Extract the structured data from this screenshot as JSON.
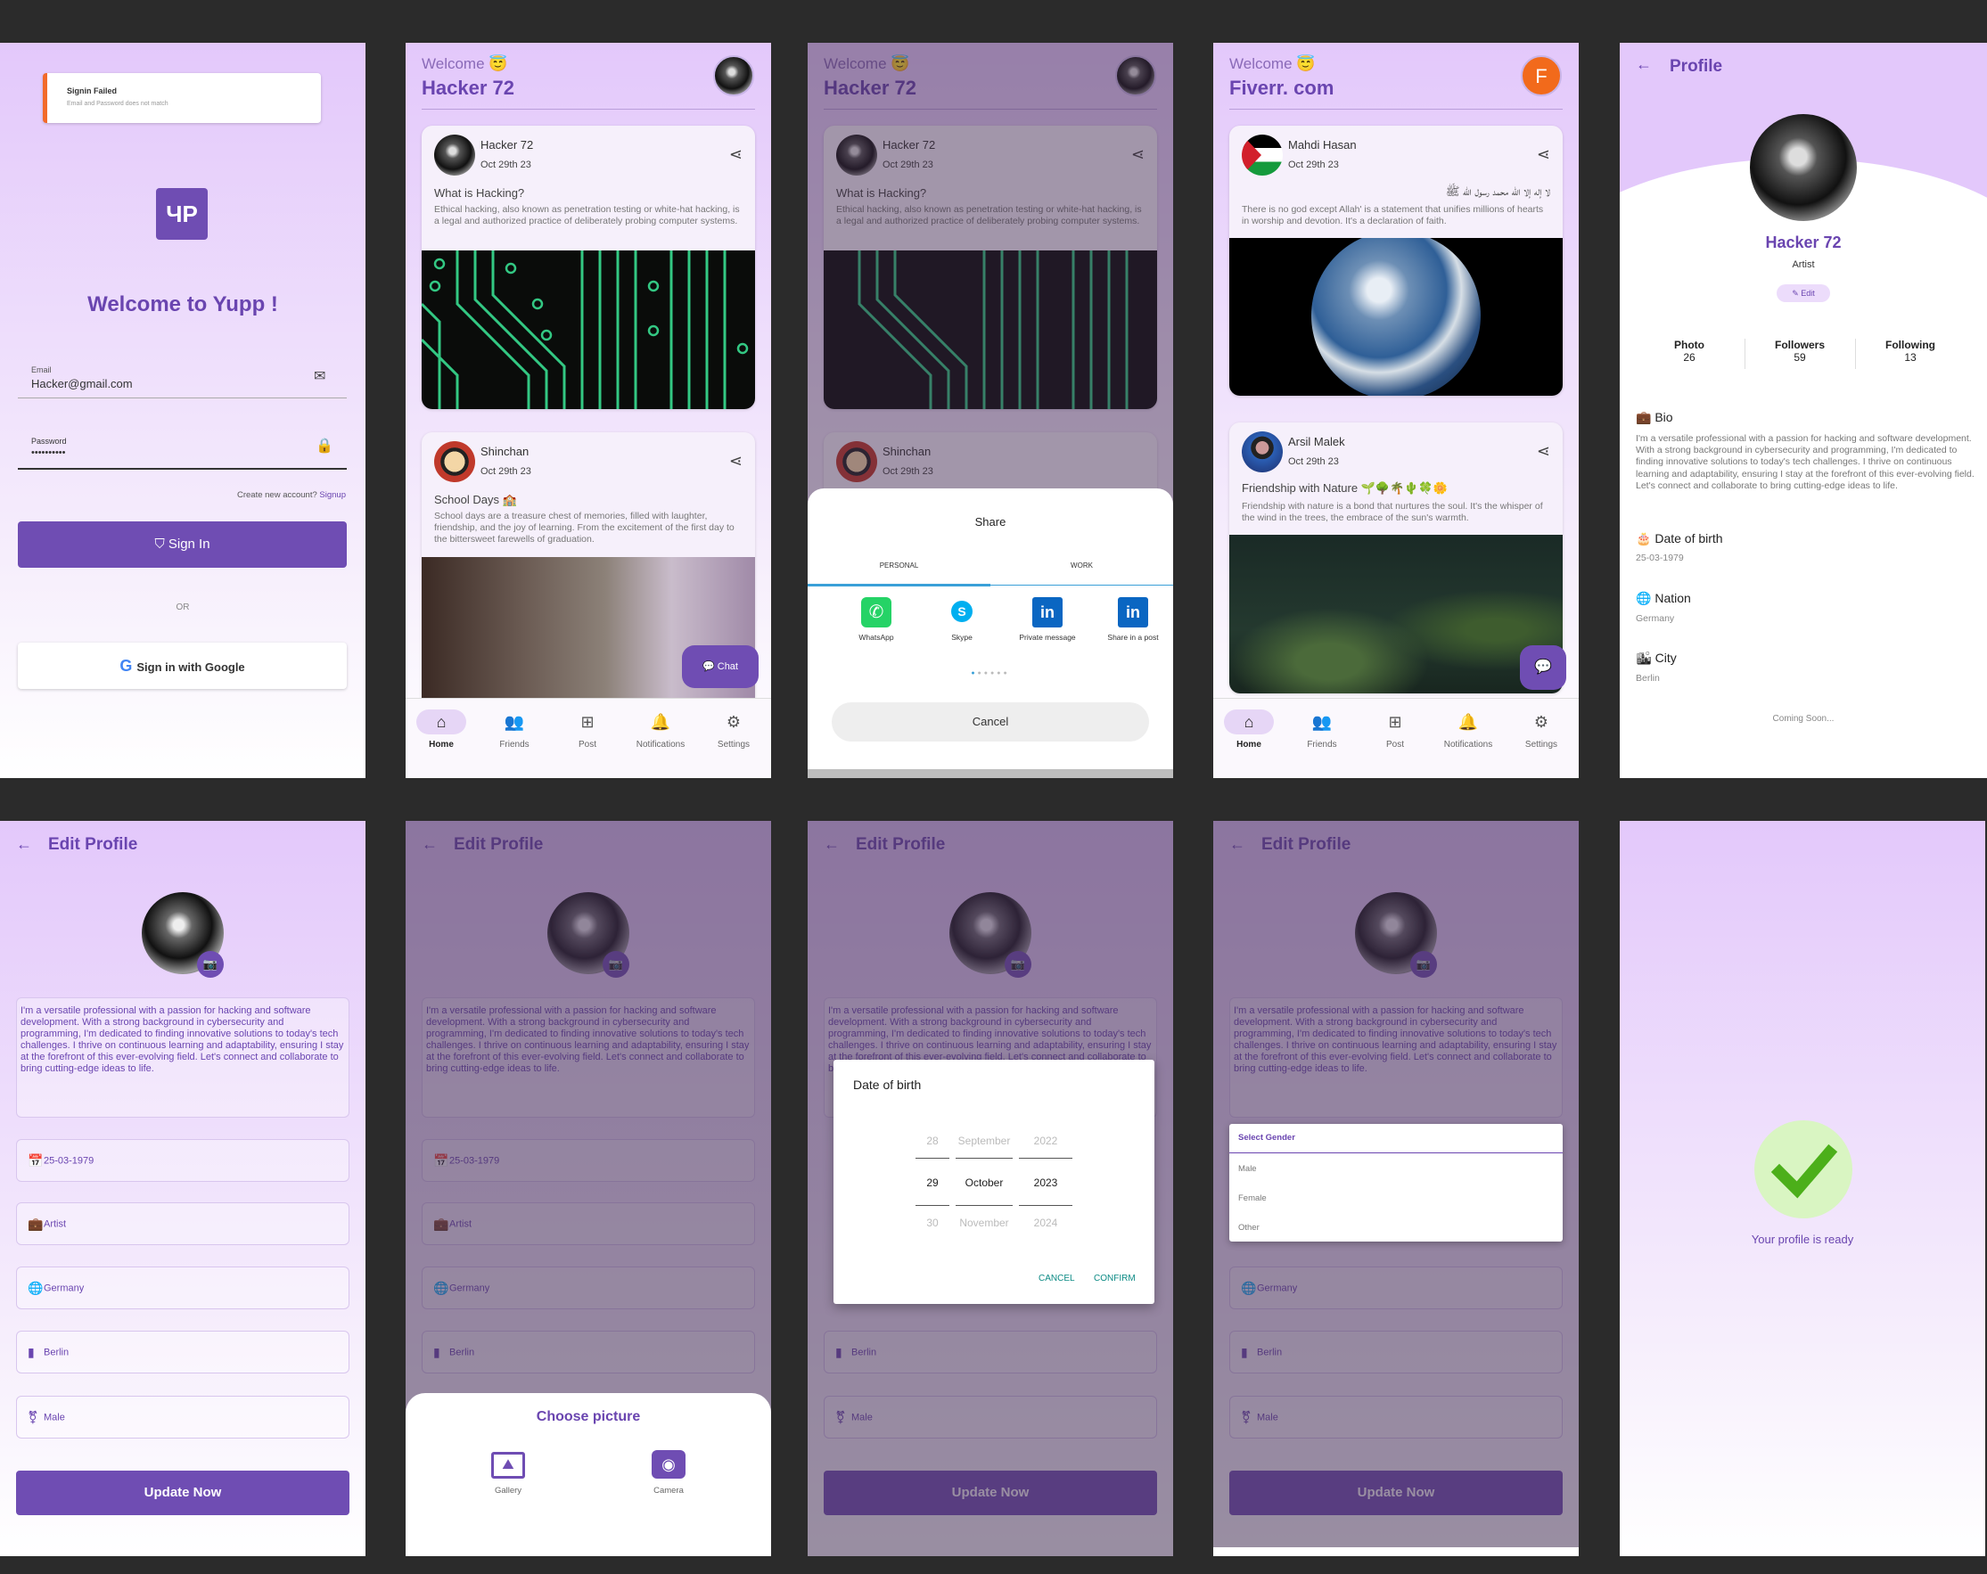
{
  "login": {
    "toast_title": "Signin Failed",
    "toast_msg": "Email and Password does not match",
    "logo": "ЧP",
    "welcome": "Welcome to Yupp !",
    "email_label": "Email",
    "email_value": "Hacker@gmail.com",
    "password_label": "Password",
    "password_value": "••••••••••",
    "create_prefix": "Create new account?",
    "signup": "Signup",
    "signin": "Sign In",
    "or": "OR",
    "google": "Sign in with Google"
  },
  "feed": {
    "welcome": "Welcome 😇",
    "user": "Hacker 72",
    "post1": {
      "name": "Hacker 72",
      "date": "Oct 29th 23",
      "title": "What is Hacking?",
      "body": "Ethical hacking, also known as penetration testing or white-hat hacking, is a legal and authorized practice of deliberately probing computer systems."
    },
    "post2": {
      "name": "Shinchan",
      "date": "Oct 29th 23",
      "title": "School Days 🏫",
      "body": "School days are a treasure chest of memories, filled with laughter, friendship, and the joy of learning. From the excitement of the first day to the bittersweet farewells of graduation."
    },
    "chat": "Chat",
    "nav": [
      "Home",
      "Friends",
      "Post",
      "Notifications",
      "Settings"
    ]
  },
  "share": {
    "title": "Share",
    "tab_personal": "PERSONAL",
    "tab_work": "WORK",
    "apps": [
      "WhatsApp",
      "Skype",
      "Private message",
      "Share in a post"
    ],
    "cancel": "Cancel"
  },
  "feed2": {
    "welcome": "Welcome 😇",
    "user": "Fiverr. com",
    "avatar_letter": "F",
    "post1": {
      "name": "Mahdi Hasan",
      "date": "Oct 29th 23",
      "title": "لا إله إلا الله محمد رسول الله ﷺ",
      "body": "There is no god except Allah' is a statement that unifies millions of hearts in worship and devotion. It's a declaration of faith."
    },
    "post2": {
      "name": "Arsil Malek",
      "date": "Oct 29th 23",
      "title": "Friendship with Nature 🌱🌳🌴🌵🍀🌼",
      "body": "Friendship with nature is a bond that nurtures the soul. It's the whisper of the wind in the trees, the embrace of the sun's warmth."
    }
  },
  "profile": {
    "title": "Profile",
    "name": "Hacker 72",
    "role": "Artist",
    "edit": "Edit",
    "stats": [
      {
        "label": "Photo",
        "value": "26"
      },
      {
        "label": "Followers",
        "value": "59"
      },
      {
        "label": "Following",
        "value": "13"
      }
    ],
    "bio_h": "Bio",
    "bio": "I'm a versatile professional with a passion for hacking and software development. With a strong background in cybersecurity and programming, I'm dedicated to finding innovative solutions to today's tech challenges. I thrive on continuous learning and adaptability, ensuring I stay at the forefront of this ever-evolving field. Let's connect and collaborate to bring cutting-edge ideas to life.",
    "dob_h": "Date of birth",
    "dob": "25-03-1979",
    "nation_h": "Nation",
    "nation": "Germany",
    "city_h": "City",
    "city": "Berlin",
    "coming": "Coming Soon..."
  },
  "edit": {
    "title": "Edit Profile",
    "bio": "I'm a versatile professional with a passion for hacking and software development. With a strong background in cybersecurity and programming, I'm dedicated to finding innovative solutions to today's tech challenges. I thrive on continuous learning and adaptability, ensuring I stay at the forefront of this ever-evolving field. Let's connect and collaborate to bring cutting-edge ideas to life.",
    "dob": "25-03-1979",
    "role": "Artist",
    "nation": "Germany",
    "city": "Berlin",
    "gender": "Male",
    "update": "Update Now"
  },
  "choose": {
    "title": "Choose picture",
    "gallery": "Gallery",
    "camera": "Camera"
  },
  "date": {
    "title": "Date of birth",
    "days": [
      "28",
      "29",
      "30"
    ],
    "months": [
      "September",
      "October",
      "November"
    ],
    "years": [
      "2022",
      "2023",
      "2024"
    ],
    "cancel": "CANCEL",
    "confirm": "CONFIRM"
  },
  "gender": {
    "title": "Select Gender",
    "options": [
      "Male",
      "Female",
      "Other"
    ]
  },
  "ready": {
    "text": "Your profile is ready"
  }
}
